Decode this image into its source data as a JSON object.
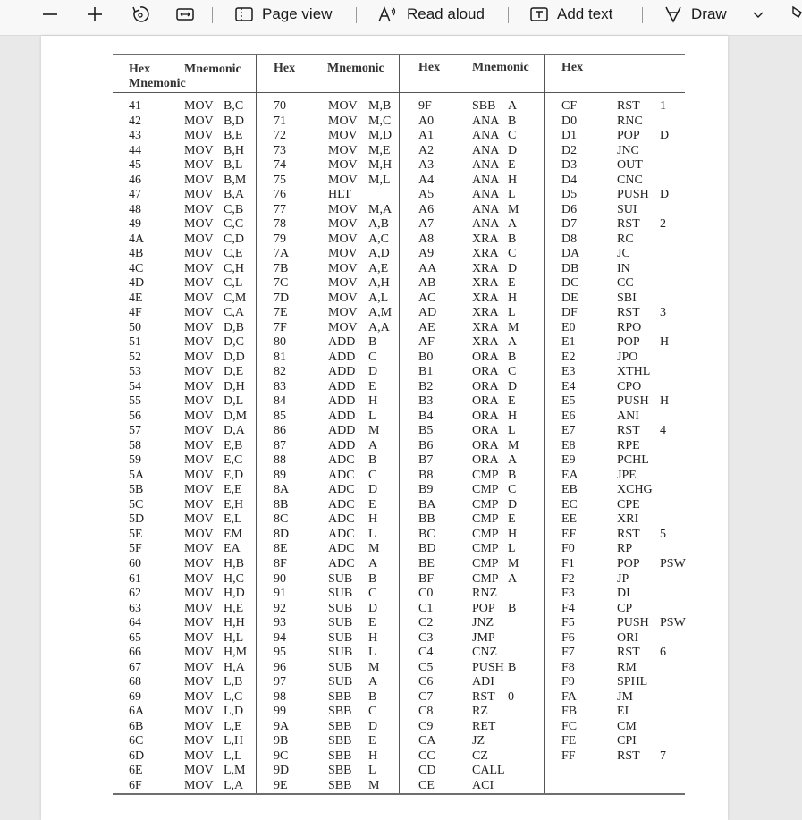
{
  "toolbar": {
    "page_view": "Page view",
    "read_aloud": "Read aloud",
    "add_text": "Add text",
    "draw": "Draw"
  },
  "table": {
    "headers": [
      {
        "hex": "Hex",
        "mnemonic": "Mnemonic",
        "second": "Mnemonic"
      },
      {
        "hex": "Hex",
        "mnemonic": "Mnemonic"
      },
      {
        "hex": "Hex",
        "mnemonic": "Mnemonic"
      },
      {
        "hex": "Hex"
      }
    ],
    "columns": [
      [
        [
          "41",
          "MOV",
          "B,C"
        ],
        [
          "42",
          "MOV",
          "B,D"
        ],
        [
          "43",
          "MOV",
          "B,E"
        ],
        [
          "44",
          "MOV",
          "B,H"
        ],
        [
          "45",
          "MOV",
          "B,L"
        ],
        [
          "46",
          "MOV",
          "B,M"
        ],
        [
          "47",
          "MOV",
          "B,A"
        ],
        [
          "48",
          "MOV",
          "C,B"
        ],
        [
          "49",
          "MOV",
          "C,C"
        ],
        [
          "4A",
          "MOV",
          "C,D"
        ],
        [
          "4B",
          "MOV",
          "C,E"
        ],
        [
          "4C",
          "MOV",
          "C,H"
        ],
        [
          "4D",
          "MOV",
          "C,L"
        ],
        [
          "4E",
          "MOV",
          "C,M"
        ],
        [
          "4F",
          "MOV",
          "C,A"
        ],
        [
          "50",
          "MOV",
          "D,B"
        ],
        [
          "51",
          "MOV",
          "D,C"
        ],
        [
          "52",
          "MOV",
          "D,D"
        ],
        [
          "53",
          "MOV",
          "D,E"
        ],
        [
          "54",
          "MOV",
          "D,H"
        ],
        [
          "55",
          "MOV",
          "D,L"
        ],
        [
          "56",
          "MOV",
          "D,M"
        ],
        [
          "57",
          "MOV",
          "D,A"
        ],
        [
          "58",
          "MOV",
          "E,B"
        ],
        [
          "59",
          "MOV",
          "E,C"
        ],
        [
          "5A",
          "MOV",
          "E,D"
        ],
        [
          "5B",
          "MOV",
          "E,E"
        ],
        [
          "5C",
          "MOV",
          "E,H"
        ],
        [
          "5D",
          "MOV",
          "E,L"
        ],
        [
          "5E",
          "MOV",
          "EM"
        ],
        [
          "5F",
          "MOV",
          "EA"
        ],
        [
          "60",
          "MOV",
          "H,B"
        ],
        [
          "61",
          "MOV",
          "H,C"
        ],
        [
          "62",
          "MOV",
          "H,D"
        ],
        [
          "63",
          "MOV",
          "H,E"
        ],
        [
          "64",
          "MOV",
          "H,H"
        ],
        [
          "65",
          "MOV",
          "H,L"
        ],
        [
          "66",
          "MOV",
          "H,M"
        ],
        [
          "67",
          "MOV",
          "H,A"
        ],
        [
          "68",
          "MOV",
          "L,B"
        ],
        [
          "69",
          "MOV",
          "L,C"
        ],
        [
          "6A",
          "MOV",
          "L,D"
        ],
        [
          "6B",
          "MOV",
          "L,E"
        ],
        [
          "6C",
          "MOV",
          "L,H"
        ],
        [
          "6D",
          "MOV",
          "L,L"
        ],
        [
          "6E",
          "MOV",
          "L,M"
        ],
        [
          "6F",
          "MOV",
          "L,A"
        ]
      ],
      [
        [
          "70",
          "MOV",
          "M,B"
        ],
        [
          "71",
          "MOV",
          "M,C"
        ],
        [
          "72",
          "MOV",
          "M,D"
        ],
        [
          "73",
          "MOV",
          "M,E"
        ],
        [
          "74",
          "MOV",
          "M,H"
        ],
        [
          "75",
          "MOV",
          "M,L"
        ],
        [
          "76",
          "HLT",
          ""
        ],
        [
          "77",
          "MOV",
          "M,A"
        ],
        [
          "78",
          "MOV",
          "A,B"
        ],
        [
          "79",
          "MOV",
          "A,C"
        ],
        [
          "7A",
          "MOV",
          "A,D"
        ],
        [
          "7B",
          "MOV",
          "A,E"
        ],
        [
          "7C",
          "MOV",
          "A,H"
        ],
        [
          "7D",
          "MOV",
          "A,L"
        ],
        [
          "7E",
          "MOV",
          "A,M"
        ],
        [
          "7F",
          "MOV",
          "A,A"
        ],
        [
          "80",
          "ADD",
          "B"
        ],
        [
          "81",
          "ADD",
          "C"
        ],
        [
          "82",
          "ADD",
          "D"
        ],
        [
          "83",
          "ADD",
          "E"
        ],
        [
          "84",
          "ADD",
          "H"
        ],
        [
          "85",
          "ADD",
          "L"
        ],
        [
          "86",
          "ADD",
          "M"
        ],
        [
          "87",
          "ADD",
          "A"
        ],
        [
          "88",
          "ADC",
          "B"
        ],
        [
          "89",
          "ADC",
          "C"
        ],
        [
          "8A",
          "ADC",
          "D"
        ],
        [
          "8B",
          "ADC",
          "E"
        ],
        [
          "8C",
          "ADC",
          "H"
        ],
        [
          "8D",
          "ADC",
          "L"
        ],
        [
          "8E",
          "ADC",
          "M"
        ],
        [
          "8F",
          "ADC",
          "A"
        ],
        [
          "90",
          "SUB",
          "B"
        ],
        [
          "91",
          "SUB",
          "C"
        ],
        [
          "92",
          "SUB",
          "D"
        ],
        [
          "93",
          "SUB",
          "E"
        ],
        [
          "94",
          "SUB",
          "H"
        ],
        [
          "95",
          "SUB",
          "L"
        ],
        [
          "96",
          "SUB",
          "M"
        ],
        [
          "97",
          "SUB",
          "A"
        ],
        [
          "98",
          "SBB",
          "B"
        ],
        [
          "99",
          "SBB",
          "C"
        ],
        [
          "9A",
          "SBB",
          "D"
        ],
        [
          "9B",
          "SBB",
          "E"
        ],
        [
          "9C",
          "SBB",
          "H"
        ],
        [
          "9D",
          "SBB",
          "L"
        ],
        [
          "9E",
          "SBB",
          "M"
        ]
      ],
      [
        [
          "9F",
          "SBB",
          "A"
        ],
        [
          "A0",
          "ANA",
          "B"
        ],
        [
          "A1",
          "ANA",
          "C"
        ],
        [
          "A2",
          "ANA",
          "D"
        ],
        [
          "A3",
          "ANA",
          "E"
        ],
        [
          "A4",
          "ANA",
          "H"
        ],
        [
          "A5",
          "ANA",
          "L"
        ],
        [
          "A6",
          "ANA",
          "M"
        ],
        [
          "A7",
          "ANA",
          "A"
        ],
        [
          "A8",
          "XRA",
          "B"
        ],
        [
          "A9",
          "XRA",
          "C"
        ],
        [
          "AA",
          "XRA",
          "D"
        ],
        [
          "AB",
          "XRA",
          "E"
        ],
        [
          "AC",
          "XRA",
          "H"
        ],
        [
          "AD",
          "XRA",
          "L"
        ],
        [
          "AE",
          "XRA",
          "M"
        ],
        [
          "AF",
          "XRA",
          "A"
        ],
        [
          "B0",
          "ORA",
          "B"
        ],
        [
          "B1",
          "ORA",
          "C"
        ],
        [
          "B2",
          "ORA",
          "D"
        ],
        [
          "B3",
          "ORA",
          "E"
        ],
        [
          "B4",
          "ORA",
          "H"
        ],
        [
          "B5",
          "ORA",
          "L"
        ],
        [
          "B6",
          "ORA",
          "M"
        ],
        [
          "B7",
          "ORA",
          "A"
        ],
        [
          "B8",
          "CMP",
          "B"
        ],
        [
          "B9",
          "CMP",
          "C"
        ],
        [
          "BA",
          "CMP",
          "D"
        ],
        [
          "BB",
          "CMP",
          "E"
        ],
        [
          "BC",
          "CMP",
          "H"
        ],
        [
          "BD",
          "CMP",
          "L"
        ],
        [
          "BE",
          "CMP",
          "M"
        ],
        [
          "BF",
          "CMP",
          "A"
        ],
        [
          "C0",
          "RNZ",
          ""
        ],
        [
          "C1",
          "POP",
          "B"
        ],
        [
          "C2",
          "JNZ",
          ""
        ],
        [
          "C3",
          "JMP",
          ""
        ],
        [
          "C4",
          "CNZ",
          ""
        ],
        [
          "C5",
          "PUSH",
          "B"
        ],
        [
          "C6",
          "ADI",
          ""
        ],
        [
          "C7",
          "RST",
          "0"
        ],
        [
          "C8",
          "RZ",
          ""
        ],
        [
          "C9",
          "RET",
          ""
        ],
        [
          "CA",
          "JZ",
          ""
        ],
        [
          "CC",
          "CZ",
          ""
        ],
        [
          "CD",
          "CALL",
          ""
        ],
        [
          "CE",
          "ACI",
          ""
        ]
      ],
      [
        [
          "CF",
          "RST",
          "1"
        ],
        [
          "D0",
          "RNC",
          ""
        ],
        [
          "D1",
          "POP",
          "D"
        ],
        [
          "D2",
          "JNC",
          ""
        ],
        [
          "D3",
          "OUT",
          ""
        ],
        [
          "D4",
          "CNC",
          ""
        ],
        [
          "D5",
          "PUSH",
          "D"
        ],
        [
          "D6",
          "SUI",
          ""
        ],
        [
          "D7",
          "RST",
          "2"
        ],
        [
          "D8",
          "RC",
          ""
        ],
        [
          "DA",
          "JC",
          ""
        ],
        [
          "DB",
          "IN",
          ""
        ],
        [
          "DC",
          "CC",
          ""
        ],
        [
          "DE",
          "SBI",
          ""
        ],
        [
          "DF",
          "RST",
          "3"
        ],
        [
          "E0",
          "RPO",
          ""
        ],
        [
          "E1",
          "POP",
          "H"
        ],
        [
          "E2",
          "JPO",
          ""
        ],
        [
          "E3",
          "XTHL",
          ""
        ],
        [
          "E4",
          "CPO",
          ""
        ],
        [
          "E5",
          "PUSH",
          "H"
        ],
        [
          "E6",
          "ANI",
          ""
        ],
        [
          "E7",
          "RST",
          "4"
        ],
        [
          "E8",
          "RPE",
          ""
        ],
        [
          "E9",
          "PCHL",
          ""
        ],
        [
          "EA",
          "JPE",
          ""
        ],
        [
          "EB",
          "XCHG",
          ""
        ],
        [
          "EC",
          "CPE",
          ""
        ],
        [
          "EE",
          "XRI",
          ""
        ],
        [
          "EF",
          "RST",
          "5"
        ],
        [
          "F0",
          "RP",
          ""
        ],
        [
          "F1",
          "POP",
          "PSW"
        ],
        [
          "F2",
          "JP",
          ""
        ],
        [
          "F3",
          "DI",
          ""
        ],
        [
          "F4",
          "CP",
          ""
        ],
        [
          "F5",
          "PUSH",
          "PSW"
        ],
        [
          "F6",
          "ORI",
          ""
        ],
        [
          "F7",
          "RST",
          "6"
        ],
        [
          "F8",
          "RM",
          ""
        ],
        [
          "F9",
          "SPHL",
          ""
        ],
        [
          "FA",
          "JM",
          ""
        ],
        [
          "FB",
          "EI",
          ""
        ],
        [
          "FC",
          "CM",
          ""
        ],
        [
          "FE",
          "CPI",
          ""
        ],
        [
          "FF",
          "RST",
          "7"
        ]
      ]
    ]
  }
}
